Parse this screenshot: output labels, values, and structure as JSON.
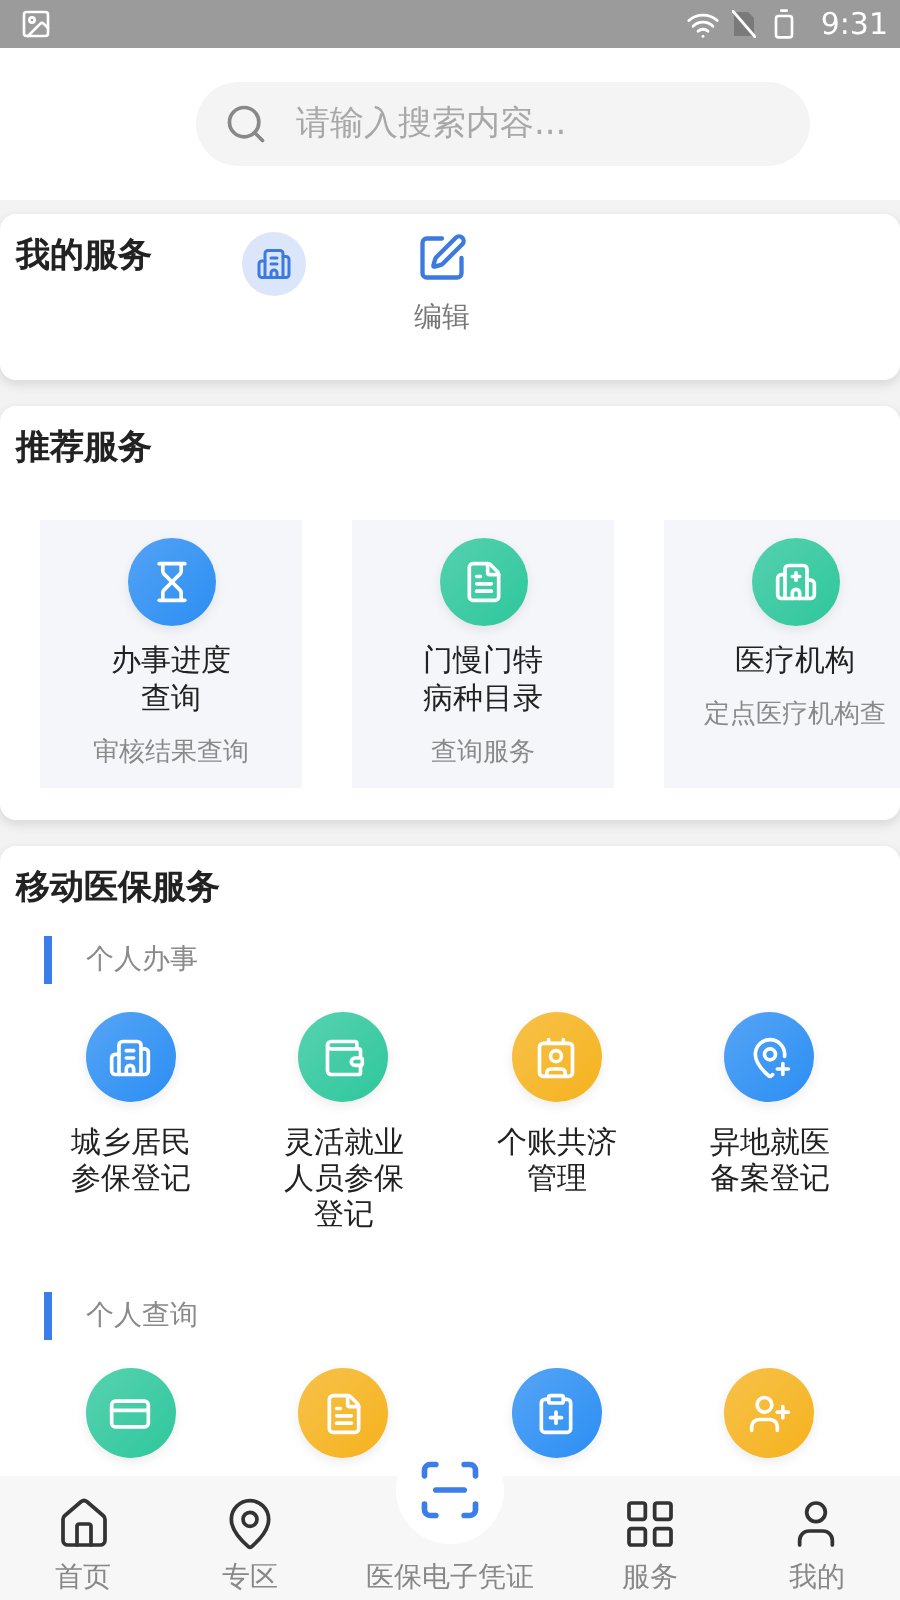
{
  "status_bar": {
    "time": "9:31"
  },
  "search": {
    "placeholder": "请输入搜索内容..."
  },
  "my_services": {
    "title": "我的服务",
    "items": [
      {
        "kind": "shortcut",
        "color": "#3d7ae0"
      },
      {
        "kind": "edit",
        "label": "编辑"
      }
    ]
  },
  "recommended": {
    "title": "推荐服务",
    "items": [
      {
        "title": "办事进度查询",
        "subtitle": "审核结果查询",
        "color": "#2b8ef3"
      },
      {
        "title": "门慢门特病种目录",
        "subtitle": "查询服务",
        "color": "#2ec79c"
      },
      {
        "title": "医疗机构",
        "subtitle": "定点医疗机构查",
        "color": "#2ec79c"
      }
    ]
  },
  "mobile_services": {
    "title": "移动医保服务",
    "groups": [
      {
        "title": "个人办事",
        "items": [
          {
            "label": "城乡居民参保登记",
            "color": "#2b8ef3"
          },
          {
            "label": "灵活就业人员参保登记",
            "color": "#2ec79c"
          },
          {
            "label": "个账共济管理",
            "color": "#f5b21d"
          },
          {
            "label": "异地就医备案登记",
            "color": "#2b8ef3"
          }
        ]
      },
      {
        "title": "个人查询",
        "items": [
          {
            "color": "#2ec79c"
          },
          {
            "color": "#f5b21d"
          },
          {
            "color": "#2b8ef3"
          },
          {
            "color": "#f5b21d"
          }
        ]
      }
    ]
  },
  "bottom_nav": [
    {
      "label": "首页",
      "selected": false
    },
    {
      "label": "专区",
      "selected": false
    },
    {
      "label": "医保电子凭证",
      "selected": false,
      "kind": "center"
    },
    {
      "label": "服务",
      "selected": false
    },
    {
      "label": "我的",
      "selected": false
    }
  ]
}
